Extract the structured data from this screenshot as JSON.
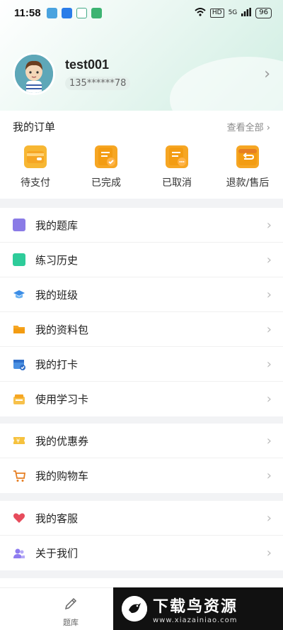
{
  "status": {
    "time": "11:58",
    "battery": "96",
    "hd": "HD",
    "net": "5G"
  },
  "profile": {
    "username": "test001",
    "phone": "135******78"
  },
  "orders": {
    "title": "我的订单",
    "view_all": "查看全部",
    "items": [
      {
        "label": "待支付",
        "icon": "wallet-icon"
      },
      {
        "label": "已完成",
        "icon": "order-complete-icon"
      },
      {
        "label": "已取消",
        "icon": "order-cancel-icon"
      },
      {
        "label": "退款/售后",
        "icon": "refund-icon"
      }
    ]
  },
  "menu": {
    "group1": [
      {
        "label": "我的题库",
        "icon": "question-bank-icon"
      },
      {
        "label": "练习历史",
        "icon": "history-icon"
      },
      {
        "label": "我的班级",
        "icon": "graduation-cap-icon"
      },
      {
        "label": "我的资料包",
        "icon": "folder-icon"
      },
      {
        "label": "我的打卡",
        "icon": "calendar-check-icon"
      },
      {
        "label": "使用学习卡",
        "icon": "card-icon"
      }
    ],
    "group2": [
      {
        "label": "我的优惠券",
        "icon": "coupon-icon"
      },
      {
        "label": "我的购物车",
        "icon": "cart-icon"
      }
    ],
    "group3": [
      {
        "label": "我的客服",
        "icon": "heart-icon"
      },
      {
        "label": "关于我们",
        "icon": "people-icon"
      }
    ]
  },
  "bottom_nav": {
    "tiku": "题库"
  },
  "watermark": {
    "title": "下载鸟资源",
    "url": "www.xiazainiao.com"
  },
  "colors": {
    "accent": "#f6a623",
    "header_green": "#cfeee2"
  }
}
